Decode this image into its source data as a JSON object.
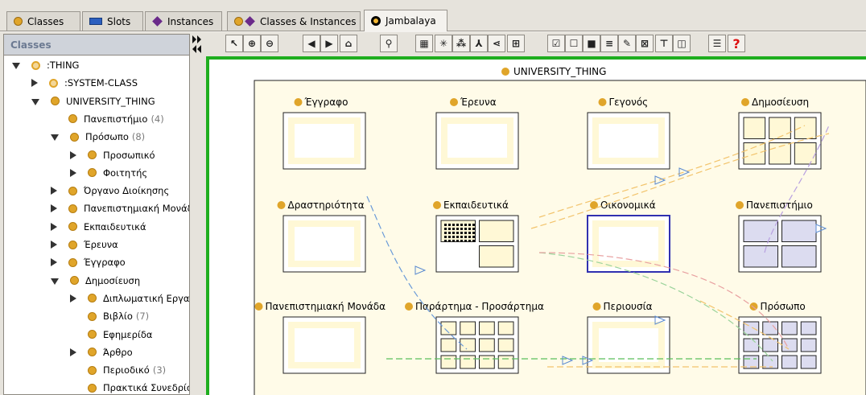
{
  "tabs": [
    {
      "label": "Classes",
      "icon": "class-dot-icon"
    },
    {
      "label": "Slots",
      "icon": "slot-bar-icon"
    },
    {
      "label": "Instances",
      "icon": "instance-diamond-icon"
    },
    {
      "label": "Classes & Instances",
      "icon": "class-instance-icon"
    },
    {
      "label": "Jambalaya",
      "icon": "jambalaya-target-icon"
    }
  ],
  "left_panel": {
    "header": "Classes",
    "tree": [
      {
        "label": ":THING",
        "count": "",
        "expander": "down",
        "system": true
      },
      {
        "label": ":SYSTEM-CLASS",
        "count": "",
        "expander": "right",
        "system": true
      },
      {
        "label": "UNIVERSITY_THING",
        "count": "",
        "expander": "down",
        "system": false
      },
      {
        "label": "Πανεπιστήμιο",
        "count": "(4)",
        "expander": "none",
        "system": false
      },
      {
        "label": "Πρόσωπο",
        "count": "(8)",
        "expander": "down",
        "system": false
      },
      {
        "label": "Προσωπικό",
        "count": "",
        "expander": "right",
        "system": false
      },
      {
        "label": "Φοιτητής",
        "count": "",
        "expander": "right",
        "system": false
      },
      {
        "label": "Όργανο Διοίκησης",
        "count": "",
        "expander": "right",
        "system": false
      },
      {
        "label": "Πανεπιστημιακή Μονάδ",
        "count": "",
        "expander": "right",
        "system": false
      },
      {
        "label": "Εκπαιδευτικά",
        "count": "",
        "expander": "right",
        "system": false
      },
      {
        "label": "Έρευνα",
        "count": "",
        "expander": "right",
        "system": false
      },
      {
        "label": "Έγγραφο",
        "count": "",
        "expander": "right",
        "system": false
      },
      {
        "label": "Δημοσίευση",
        "count": "",
        "expander": "down",
        "system": false
      },
      {
        "label": "Διπλωματική Εργα",
        "count": "",
        "expander": "right",
        "system": false
      },
      {
        "label": "Βιβλίο",
        "count": "(7)",
        "expander": "none",
        "system": false
      },
      {
        "label": "Εφημερίδα",
        "count": "",
        "expander": "none",
        "system": false
      },
      {
        "label": "Άρθρο",
        "count": "",
        "expander": "right",
        "system": false
      },
      {
        "label": "Περιοδικό",
        "count": "(3)",
        "expander": "none",
        "system": false
      },
      {
        "label": "Πρακτικά Συνεδρίοι",
        "count": "",
        "expander": "none",
        "system": false
      }
    ]
  },
  "toolbar": [
    {
      "name": "select-arrow-icon",
      "glyph": "↖"
    },
    {
      "name": "zoom-in-icon",
      "glyph": "⊕"
    },
    {
      "name": "zoom-out-icon",
      "glyph": "⊖"
    },
    {
      "name": "back-icon",
      "glyph": "◀"
    },
    {
      "name": "forward-icon",
      "glyph": "▶"
    },
    {
      "name": "home-icon",
      "glyph": "⌂"
    },
    {
      "name": "binoculars-icon",
      "glyph": "⚲"
    },
    {
      "name": "abc-layout-icon",
      "glyph": "▦"
    },
    {
      "name": "radial-layout-icon",
      "glyph": "✳"
    },
    {
      "name": "spring-layout-icon",
      "glyph": "⁂"
    },
    {
      "name": "tree-layout-icon",
      "glyph": "⅄"
    },
    {
      "name": "horizontal-tree-icon",
      "glyph": "⋖"
    },
    {
      "name": "grid-layout-icon",
      "glyph": "⊞"
    },
    {
      "name": "checklist-icon",
      "glyph": "☑"
    },
    {
      "name": "filter-icon",
      "glyph": "☐"
    },
    {
      "name": "color-icon",
      "glyph": "■"
    },
    {
      "name": "arc-icon",
      "glyph": "≡"
    },
    {
      "name": "edit-icon",
      "glyph": "✎"
    },
    {
      "name": "nested-view-icon",
      "glyph": "⊠"
    },
    {
      "name": "tree-map-icon",
      "glyph": "⊤"
    },
    {
      "name": "window-icon",
      "glyph": "◫"
    },
    {
      "name": "options-icon",
      "glyph": "☰"
    },
    {
      "name": "help-icon",
      "glyph": "?"
    }
  ],
  "canvas": {
    "root_label": "UNIVERSITY_THING",
    "nodes": [
      {
        "label": "Έγγραφο",
        "kind": "empty",
        "selected": false
      },
      {
        "label": "Έρευνα",
        "kind": "empty",
        "selected": false
      },
      {
        "label": "Γεγονός",
        "kind": "empty",
        "selected": false
      },
      {
        "label": "Δημοσίευση",
        "kind": "children",
        "selected": false
      },
      {
        "label": "Δραστηριότητα",
        "kind": "empty",
        "selected": false
      },
      {
        "label": "Εκπαιδευτικά",
        "kind": "children",
        "selected": false
      },
      {
        "label": "Οικονομικά",
        "kind": "empty",
        "selected": true
      },
      {
        "label": "Πανεπιστήμιο",
        "kind": "children",
        "selected": false
      },
      {
        "label": "Πανεπιστημιακή Μονάδα",
        "kind": "empty",
        "selected": false
      },
      {
        "label": "Παράρτημα - Προσάρτημα",
        "kind": "children",
        "selected": false
      },
      {
        "label": "Περιουσία",
        "kind": "empty",
        "selected": false
      },
      {
        "label": "Πρόσωπο",
        "kind": "children",
        "selected": false
      }
    ]
  },
  "colors": {
    "class_dot": "#e0a52a",
    "canvas_border": "#1fae1f",
    "selected_node_border": "#3030b0",
    "node_fill": "#fff8d6"
  }
}
